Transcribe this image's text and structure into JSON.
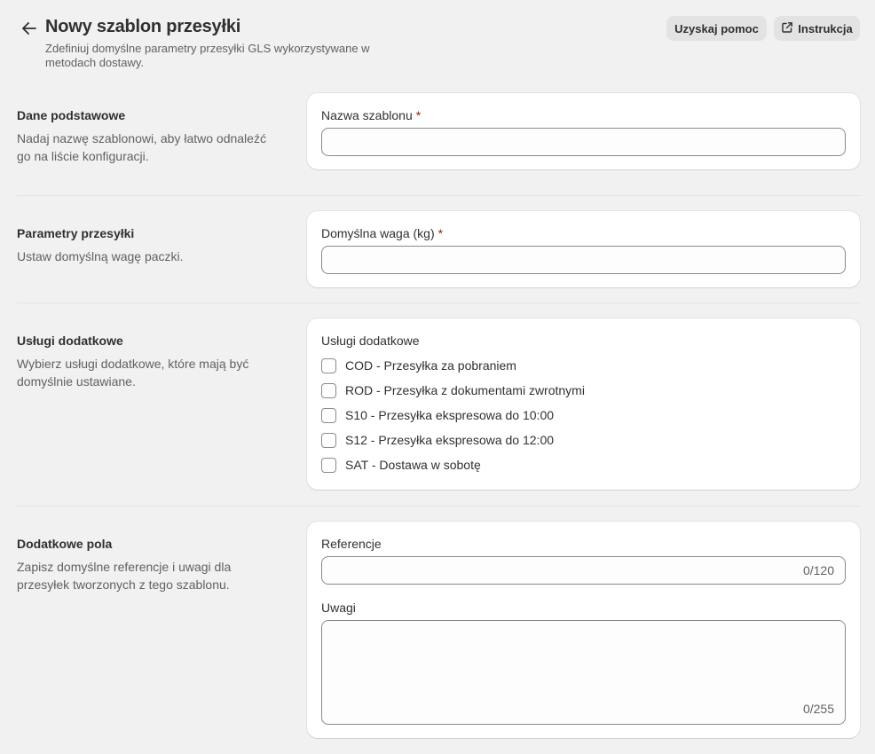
{
  "header": {
    "title": "Nowy szablon przesyłki",
    "subtitle": "Zdefiniuj domyślne parametry przesyłki GLS wykorzystywane w metodach dostawy.",
    "help_button": "Uzyskaj pomoc",
    "manual_button": "Instrukcja"
  },
  "sections": {
    "basic": {
      "title": "Dane podstawowe",
      "description": "Nadaj nazwę szablonowi, aby łatwo odnaleźć go na liście konfiguracji.",
      "field_label": "Nazwa szablonu",
      "field_value": "",
      "required_mark": "*"
    },
    "shipment": {
      "title": "Parametry przesyłki",
      "description": "Ustaw domyślną wagę paczki.",
      "field_label": "Domyślna waga (kg)",
      "field_value": "",
      "required_mark": "*"
    },
    "services": {
      "title": "Usługi dodatkowe",
      "description": "Wybierz usługi dodatkowe, które mają być domyślnie ustawiane.",
      "group_label": "Usługi dodatkowe",
      "options": [
        {
          "label": "COD - Przesyłka za pobraniem",
          "checked": false
        },
        {
          "label": "ROD - Przesyłka z dokumentami zwrotnymi",
          "checked": false
        },
        {
          "label": "S10 - Przesyłka ekspresowa do 10:00",
          "checked": false
        },
        {
          "label": "S12 - Przesyłka ekspresowa do 12:00",
          "checked": false
        },
        {
          "label": "SAT - Dostawa w sobotę",
          "checked": false
        }
      ]
    },
    "extra": {
      "title": "Dodatkowe pola",
      "description": "Zapisz domyślne referencje i uwagi dla przesyłek tworzonych z tego szablonu.",
      "references_label": "Referencje",
      "references_value": "",
      "references_counter": "0/120",
      "notes_label": "Uwagi",
      "notes_value": "",
      "notes_counter": "0/255"
    }
  }
}
